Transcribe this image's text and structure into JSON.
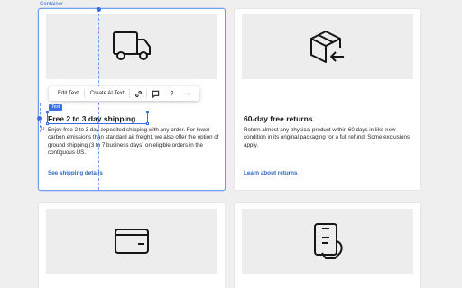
{
  "editor": {
    "container_label": "Container",
    "text_tag": "Text",
    "toolbar": {
      "edit_text": "Edit Text",
      "create_ai_text": "Create AI Text",
      "link_icon": "link-icon",
      "comment_icon": "comment-icon",
      "help_label": "?",
      "more_label": "···"
    },
    "accent_color": "#3b6fe0"
  },
  "cards": [
    {
      "icon": "truck-icon",
      "title": "Free 2 to 3 day shipping",
      "body": "Enjoy free 2 to 3 day expedited shipping with any order. For lower carbon emissions than standard air freight, we also offer the option of ground shipping (3 to 7 business days) on eligible orders in the contiguous US.",
      "link": "See shipping details"
    },
    {
      "icon": "box-return-icon",
      "title": "60-day free returns",
      "body": "Return almost any physical product within 60 days in like-new condition in its original packaging for a full refund. Some exclusions apply.",
      "link": "Learn about returns"
    },
    {
      "icon": "wallet-icon"
    },
    {
      "icon": "hand-payment-icon"
    }
  ]
}
